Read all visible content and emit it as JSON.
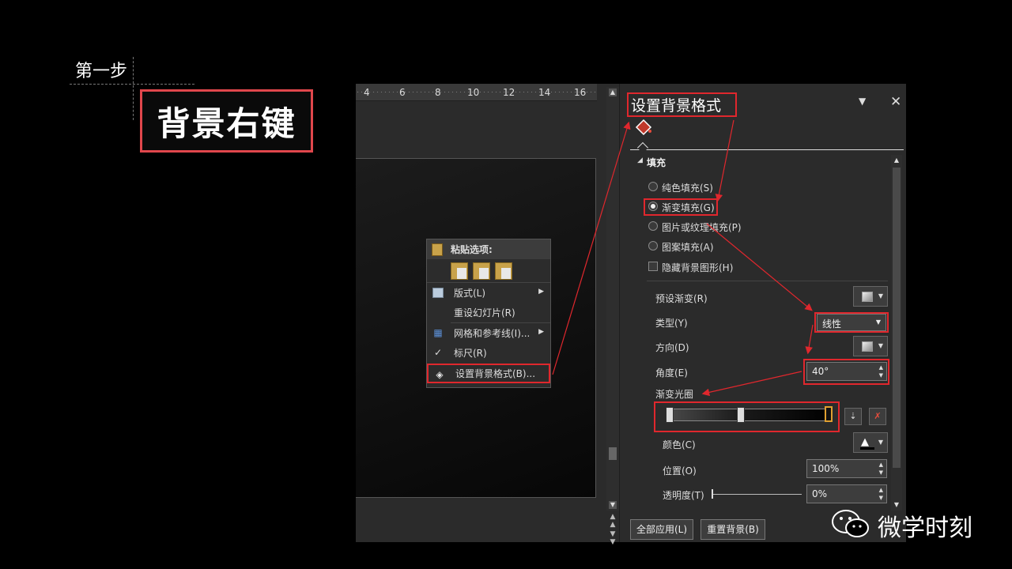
{
  "heading": {
    "step": "第一步",
    "title": "背景右键"
  },
  "ruler": {
    "ticks": [
      "4",
      "6",
      "8",
      "10",
      "12",
      "14",
      "16"
    ]
  },
  "context_menu": {
    "paste_header": "粘贴选项:",
    "items": [
      {
        "label": "版式(L)",
        "icon": "layout-icon",
        "submenu": true
      },
      {
        "label": "重设幻灯片(R)",
        "icon": "",
        "submenu": false
      },
      {
        "label": "网格和参考线(I)...",
        "icon": "grid-icon",
        "submenu": true
      },
      {
        "label": "标尺(R)",
        "icon": "check-icon",
        "submenu": false
      },
      {
        "label": "设置背景格式(B)...",
        "icon": "format-background-icon",
        "submenu": false
      }
    ]
  },
  "pane": {
    "title": "设置背景格式",
    "section_fill": "填充",
    "fill_options": {
      "solid": "纯色填充(S)",
      "gradient": "渐变填充(G)",
      "picture": "图片或纹理填充(P)",
      "pattern": "图案填充(A)"
    },
    "hide_bg_graphics": "隐藏背景图形(H)",
    "preset_gradient_label": "预设渐变(R)",
    "type_label": "类型(Y)",
    "type_value": "线性",
    "direction_label": "方向(D)",
    "angle_label": "角度(E)",
    "angle_value": "40°",
    "gradient_stops_label": "渐变光圈",
    "color_label": "颜色(C)",
    "position_label": "位置(O)",
    "position_value": "100%",
    "transparency_label": "透明度(T)",
    "transparency_value": "0%",
    "apply_all": "全部应用(L)",
    "reset_bg": "重置背景(B)"
  },
  "watermark": {
    "text": "微学时刻"
  },
  "colors": {
    "highlight": "#e0272d",
    "title_border": "#e0474c"
  }
}
